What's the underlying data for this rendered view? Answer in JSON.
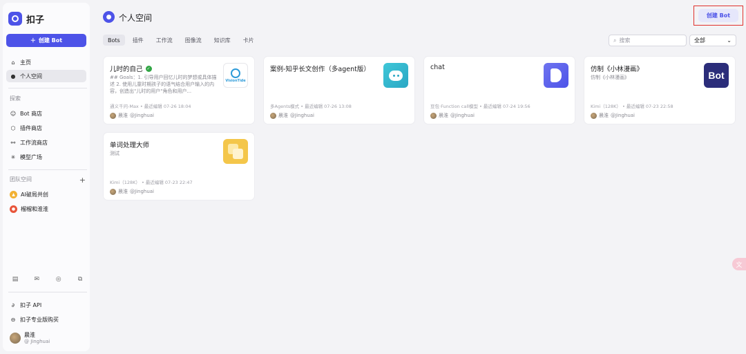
{
  "sidebar": {
    "logo_text": "扣子",
    "create_button": "创建 Bot",
    "nav": [
      {
        "label": "主页",
        "icon": "home-icon"
      },
      {
        "label": "个人空间",
        "icon": "user-icon"
      }
    ],
    "explore_label": "探索",
    "explore": [
      {
        "label": "Bot 商店",
        "icon": "bot-icon"
      },
      {
        "label": "插件商店",
        "icon": "plugin-icon"
      },
      {
        "label": "工作流商店",
        "icon": "workflow-icon"
      },
      {
        "label": "模型广场",
        "icon": "model-icon"
      }
    ],
    "team_label": "团队空间",
    "teams": [
      {
        "label": "AI破局共创",
        "color": "#f2b133"
      },
      {
        "label": "榴榴和淮淮",
        "color": "#e8553b"
      }
    ],
    "bottom_links": [
      {
        "label": "扣子 API",
        "icon": "api-icon"
      },
      {
        "label": "扣子专业版购买",
        "icon": "pro-icon"
      }
    ],
    "user": {
      "name": "晨淮",
      "handle": "@ Jinghuai"
    }
  },
  "header": {
    "title": "个人空间",
    "create_button": "创建 Bot"
  },
  "tabs": [
    "Bots",
    "插件",
    "工作流",
    "图像流",
    "知识库",
    "卡片"
  ],
  "search": {
    "placeholder": "搜索"
  },
  "filter": {
    "value": "全部"
  },
  "cards": [
    {
      "title": "儿时的自己",
      "verified": true,
      "desc": "## Goals：1. 引导用户回忆儿时的梦想或具体描述 2. 使用儿童时期孩子的语气结合用户输入的内容，创造出\"儿时的用户\"角色和用户...",
      "meta": "通义千问-Max • 最近编辑 07-26 18:04",
      "author": "晨淮",
      "handle": "@Jinghuai",
      "thumb": "visiontide",
      "thumb_label": "VisionTide"
    },
    {
      "title": "案例-知乎长文创作（多agent版）",
      "verified": false,
      "desc": "",
      "meta": "多Agents模式 • 最近编辑 07-26 13:08",
      "author": "晨淮",
      "handle": "@Jinghuai",
      "thumb": "chat-bubble"
    },
    {
      "title": "chat",
      "verified": false,
      "desc": "",
      "meta": "豆包·Function call模型 • 最近编辑 07-24 19:56",
      "author": "晨淮",
      "handle": "@Jinghuai",
      "thumb": "b-logo"
    },
    {
      "title": "仿制《小林漫画》",
      "verified": false,
      "desc": "仿制《小林漫画》",
      "meta": "Kimi（128K） • 最近编辑 07-23 22:58",
      "author": "晨淮",
      "handle": "@Jinghuai",
      "thumb": "bot-text",
      "thumb_label": "Bot"
    },
    {
      "title": "单词处理大师",
      "verified": false,
      "desc": "测试",
      "meta": "Kimi（128K） • 最近编辑 07-23 22:47",
      "author": "晨淮",
      "handle": "@Jinghuai",
      "thumb": "yellow-squares"
    }
  ],
  "colors": {
    "accent": "#4d53e8",
    "highlight_border": "#e0302b"
  }
}
